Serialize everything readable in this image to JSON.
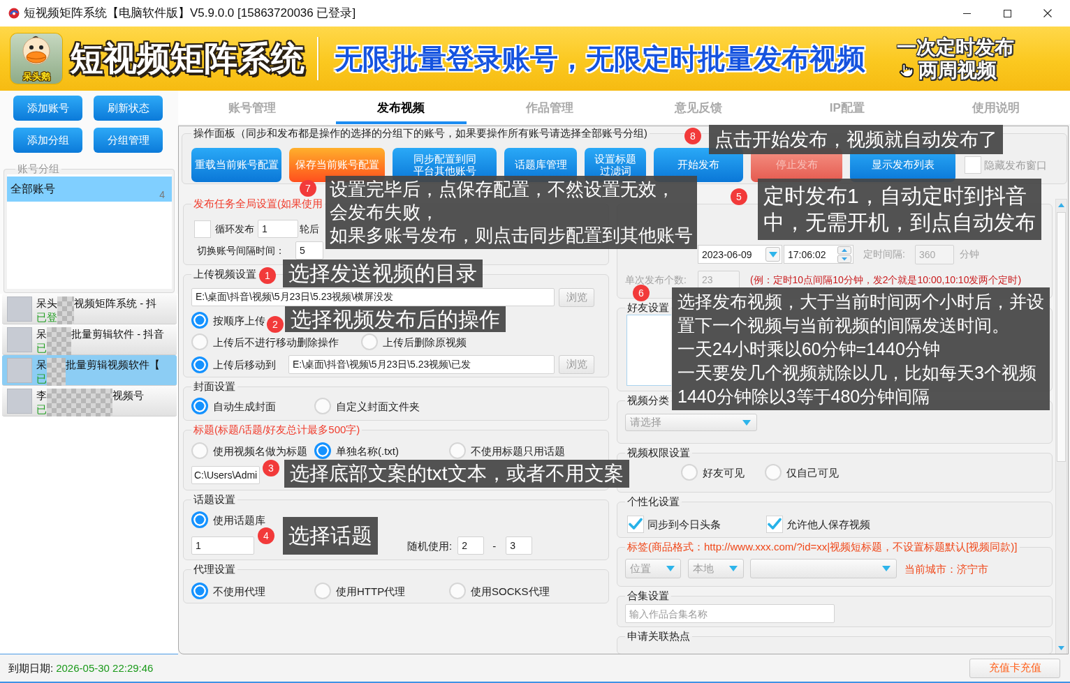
{
  "window": {
    "title": "短视频矩阵系统【电脑软件版】V5.9.0.0 [15863720036 已登录]"
  },
  "banner": {
    "logo_text": "呆头鹅",
    "product_name": "短视频矩阵系统",
    "slogan": "无限批量登录账号，无限定时批量发布视频",
    "promo_lines": [
      "一次定时发布",
      "两周视频"
    ]
  },
  "sidebar": {
    "buttons": [
      "添加账号",
      "刷新状态",
      "添加分组",
      "分组管理"
    ],
    "group_box": {
      "title": "账号分组",
      "groups": [
        {
          "name": "全部账号",
          "count": "4",
          "selected": true
        }
      ]
    },
    "accounts": [
      {
        "name_start": "呆头",
        "name_end": "视频矩阵系统 - 抖",
        "status": "已登",
        "selected": false
      },
      {
        "name_start": "呆",
        "name_end": "批量剪辑软件 - 抖音",
        "status": "已",
        "selected": false
      },
      {
        "name_start": "呆",
        "name_end": "批量剪辑视频软件【",
        "status": "已",
        "selected": true
      },
      {
        "name_start": "李",
        "name_end": "视频号",
        "status": "已",
        "selected": false
      }
    ]
  },
  "tabs": [
    {
      "label": "账号管理",
      "selected": false
    },
    {
      "label": "发布视频",
      "selected": true
    },
    {
      "label": "作品管理",
      "selected": false
    },
    {
      "label": "意见反馈",
      "selected": false
    },
    {
      "label": "IP配置",
      "selected": false
    },
    {
      "label": "使用说明",
      "selected": false
    }
  ],
  "operation_panel": {
    "title": "操作面板（同步和发布都是操作的选择的分组下的账号，如果要操作所有账号请选择全部账号分组)",
    "buttons": [
      {
        "lines": [
          "重载当前账号配置"
        ],
        "kind": "blue",
        "disabled": false
      },
      {
        "lines": [
          "保存当前账号配置"
        ],
        "kind": "orange",
        "disabled": false
      },
      {
        "lines": [
          "同步配置到同",
          "平台其他账号"
        ],
        "kind": "blue",
        "disabled": false
      },
      {
        "lines": [
          "话题库管理"
        ],
        "kind": "blue",
        "disabled": false
      },
      {
        "lines": [
          "设置标题",
          "过滤词"
        ],
        "kind": "blue",
        "disabled": false
      },
      {
        "lines": [
          "开始发布"
        ],
        "kind": "blue",
        "disabled": false
      },
      {
        "lines": [
          "停止发布"
        ],
        "kind": "red",
        "disabled": true
      },
      {
        "lines": [
          "显示发布列表"
        ],
        "kind": "blue",
        "disabled": false
      }
    ],
    "hide_window": {
      "label": "隐藏发布窗口",
      "checked": false
    }
  },
  "global_settings": {
    "title": "发布任务全局设置(如果使用",
    "loop": {
      "checked": false,
      "label": "循环发布",
      "value": "1",
      "suffix": "轮后"
    },
    "interval": {
      "label": "切换账号间隔时间：",
      "value": "5"
    }
  },
  "upload_settings": {
    "title": "上传视频设置",
    "source_path": "E:\\桌面\\抖音\\视频\\5月23日\\5.23视频\\横屏没发",
    "browse_label": "浏览",
    "order_option": {
      "label": "按顺序上传",
      "selected": true
    },
    "after_options": [
      {
        "label": "上传后不进行移动删除操作",
        "selected": false
      },
      {
        "label": "上传后删除原视频",
        "selected": false
      },
      {
        "label": "上传后移动到",
        "selected": true
      }
    ],
    "move_path": "E:\\桌面\\抖音\\视频\\5月23日\\5.23视频\\已发",
    "move_browse_label": "浏览"
  },
  "cover_settings": {
    "title": "封面设置",
    "options": [
      {
        "label": "自动生成封面",
        "selected": true
      },
      {
        "label": "自定义封面文件夹",
        "selected": false
      }
    ]
  },
  "title_settings": {
    "title": "标题(标题/话题/好友总计最多500字)",
    "options": [
      {
        "label": "使用视频名做为标题",
        "selected": false
      },
      {
        "label": "单独名称(.txt)",
        "selected": true
      },
      {
        "label": "不使用标题只用话题",
        "selected": false
      }
    ],
    "path": "C:\\Users\\Admi"
  },
  "topic_settings": {
    "title": "话题设置",
    "options": [
      {
        "label": "使用话题库",
        "selected": true
      }
    ],
    "topic_value": "1",
    "random_label": "随机使用:",
    "random_min": "2",
    "separator": "-",
    "random_max": "3"
  },
  "proxy_settings": {
    "title": "代理设置",
    "options": [
      {
        "label": "不使用代理",
        "selected": true
      },
      {
        "label": "使用HTTP代理",
        "selected": false
      },
      {
        "label": "使用SOCKS代理",
        "selected": false
      }
    ]
  },
  "publish_time": {
    "date": "2023-06-09",
    "time": "17:06:02",
    "interval_label": "定时间隔:",
    "interval_value": "360",
    "interval_unit": "分钟",
    "count_label": "单次发布个数:",
    "count_value": "23",
    "example": "(例：定时10点间隔10分钟，发2个就是10:00,10:10发两个定时)"
  },
  "friend_settings": {
    "title": "好友设置"
  },
  "category": {
    "title": "视频分类",
    "placeholder": "请选择"
  },
  "permission": {
    "title": "视频权限设置",
    "options": [
      {
        "label": "好友可见",
        "selected": false
      },
      {
        "label": "仅自己可见",
        "selected": false
      }
    ]
  },
  "personalization": {
    "title": "个性化设置",
    "options": [
      {
        "label": "同步到今日头条",
        "checked": true
      },
      {
        "label": "允许他人保存视频",
        "checked": true
      }
    ]
  },
  "tags": {
    "title": "标签(商品格式：http://www.xxx.com/?id=xx|视频短标题，不设置标题默认[视频同款)]",
    "location": "位置",
    "scope": "本地",
    "city": "当前城市：济宁市"
  },
  "collection": {
    "title": "合集设置",
    "placeholder": "输入作品合集名称"
  },
  "hotspot": {
    "title": "申请关联热点"
  },
  "status_bar": {
    "expiry_label": "到期日期:",
    "expiry_date": "2026-05-30 22:29:46",
    "recharge_button": "充值卡充值"
  },
  "callouts": [
    {
      "number": "1",
      "lines": [
        "选择发送视频的目录"
      ]
    },
    {
      "number": "2",
      "lines": [
        "选择视频发布后的操作"
      ]
    },
    {
      "number": "3",
      "lines": [
        "选择底部文案的txt文本，或者不用文案"
      ]
    },
    {
      "number": "4",
      "lines": [
        "选择话题"
      ]
    },
    {
      "number": "5",
      "lines": [
        "定时发布1，自动定时到抖音",
        "中，无需开机，到点自动发布"
      ]
    },
    {
      "number": "6",
      "lines": [
        "选择发布视频，大于当前时间两个小时后，并设",
        "置下一个视频与当前视频的间隔发送时间。",
        "一天24小时乘以60分钟=1440分钟",
        "一天要发几个视频就除以几，比如每天3个视频",
        "1440分钟除以3等于480分钟间隔"
      ]
    },
    {
      "number": "7",
      "lines": [
        "设置完毕后，点保存配置，不然设置无效，",
        "会发布失败，",
        "如果多账号发布，则点击同步配置到其他账号"
      ]
    },
    {
      "number": "8",
      "lines": [
        "点击开始发布，视频就自动发布了"
      ]
    }
  ]
}
